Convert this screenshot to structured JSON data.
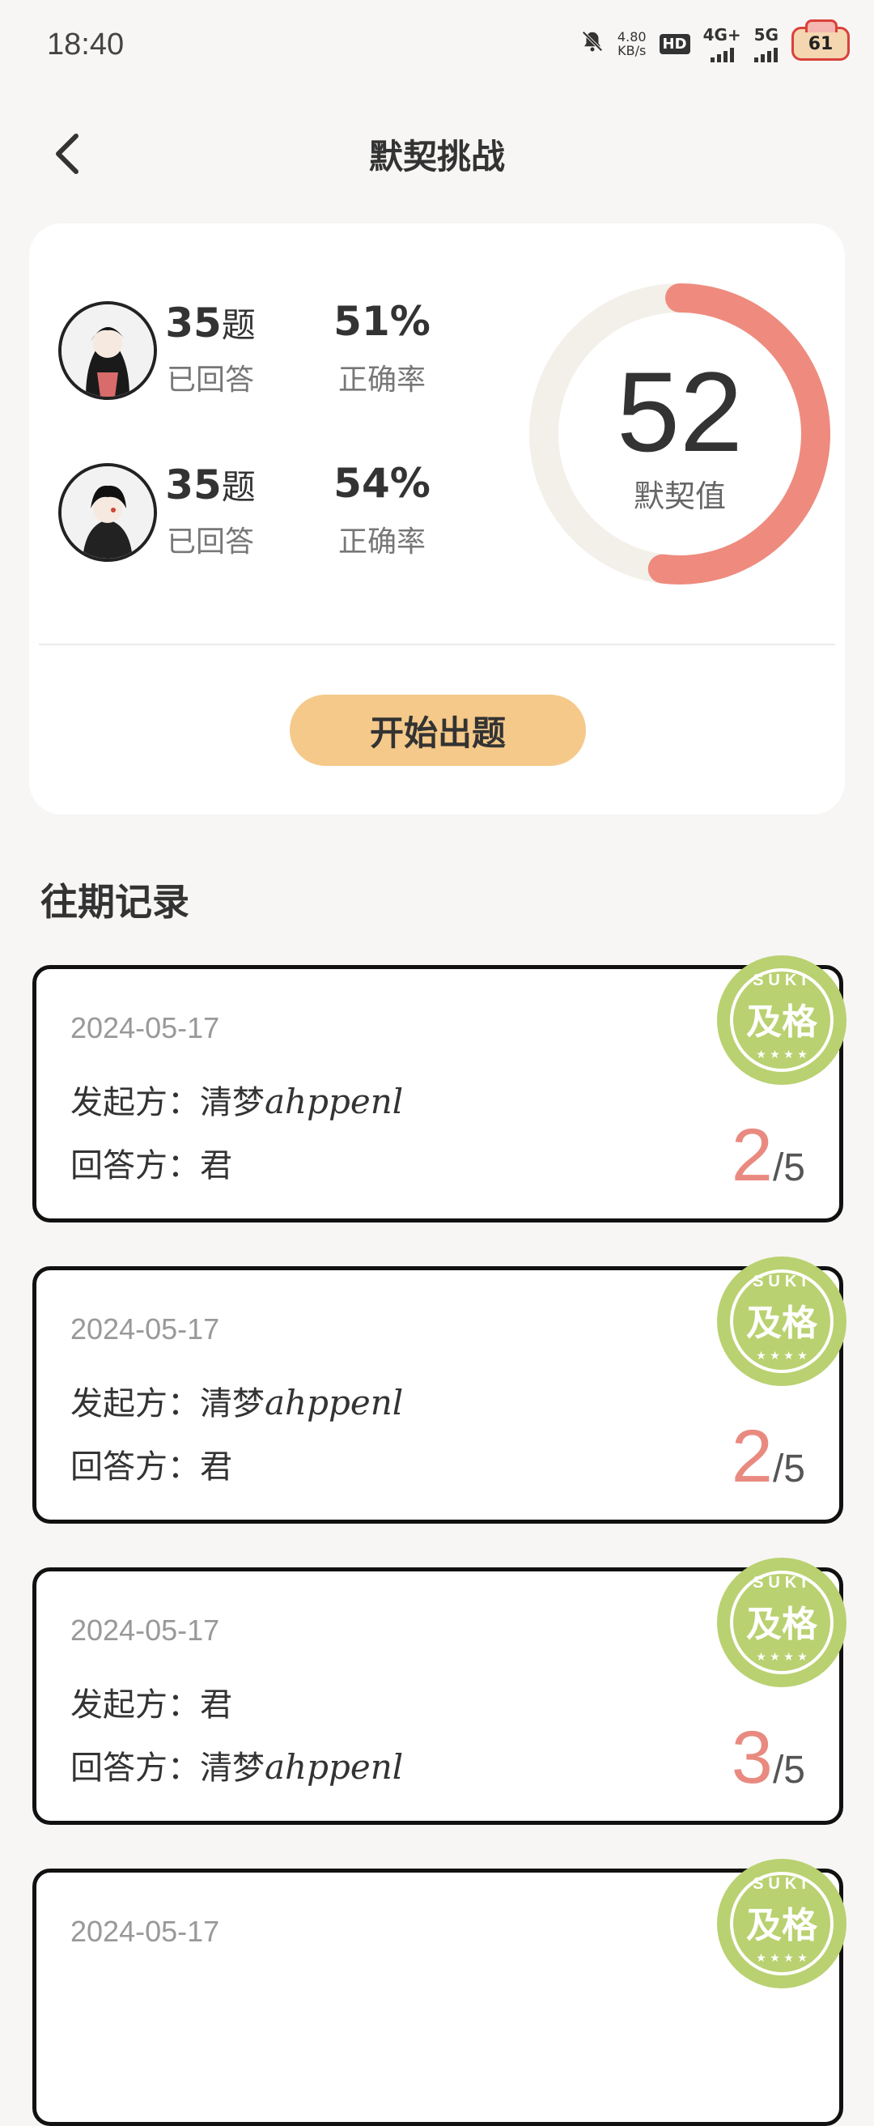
{
  "status_bar": {
    "time": "18:40",
    "net_speed_value": "4.80",
    "net_speed_unit": "KB/s",
    "hd_label": "HD",
    "net1": "4G+",
    "net2": "5G",
    "battery": "61"
  },
  "header": {
    "title": "默契挑战",
    "back_icon": "chevron-left-icon"
  },
  "stats": {
    "users": [
      {
        "answered": "35",
        "answered_unit": "题",
        "answered_label": "已回答",
        "accuracy": "51%",
        "accuracy_label": "正确率"
      },
      {
        "answered": "35",
        "answered_unit": "题",
        "answered_label": "已回答",
        "accuracy": "54%",
        "accuracy_label": "正确率"
      }
    ],
    "tacit_value": "52",
    "tacit_label": "默契值",
    "tacit_ratio": 0.52,
    "ring_color": "#ee8b7e",
    "track_color": "#f3f0ea",
    "start_button": "开始出题"
  },
  "history": {
    "title": "往期记录",
    "stamp_text": "及格",
    "stamp_ring_text": "SUKI",
    "stamp_color": "#b9d170",
    "records": [
      {
        "date": "2024-05-17",
        "initiator_label": "发起方：",
        "initiator": "清梦",
        "initiator_script": "ahppenl",
        "responder_label": "回答方：",
        "responder": "君",
        "responder_script": "",
        "score": "2",
        "total": "/5"
      },
      {
        "date": "2024-05-17",
        "initiator_label": "发起方：",
        "initiator": "清梦",
        "initiator_script": "ahppenl",
        "responder_label": "回答方：",
        "responder": "君",
        "responder_script": "",
        "score": "2",
        "total": "/5"
      },
      {
        "date": "2024-05-17",
        "initiator_label": "发起方：",
        "initiator": "君",
        "initiator_script": "",
        "responder_label": "回答方：",
        "responder": "清梦",
        "responder_script": "ahppenl",
        "score": "3",
        "total": "/5"
      },
      {
        "date": "2024-05-17"
      }
    ]
  }
}
